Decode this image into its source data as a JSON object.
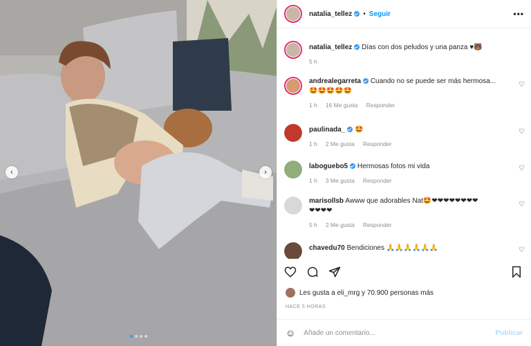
{
  "header": {
    "username": "natalia_tellez",
    "separator": "•",
    "follow_label": "Seguir",
    "more_icon": "•••"
  },
  "photo": {
    "prev_icon": "‹",
    "next_icon": "›",
    "dots": 4,
    "active_dot": 0
  },
  "caption": {
    "username": "natalia_tellez",
    "text": "Días con dos peludos y una panza ♥🐻",
    "time": "5 h"
  },
  "comments": [
    {
      "username": "andrealegarreta",
      "verified": true,
      "text": "Cuando no se puede ser más hermosa...",
      "line2": "🤩🤩🤩🤩🤩",
      "time": "1 h",
      "likes": "16 Me gusta",
      "reply": "Responder"
    },
    {
      "username": "paulinada_",
      "verified": true,
      "text": "🤩",
      "time": "1 h",
      "likes": "2 Me gusta",
      "reply": "Responder"
    },
    {
      "username": "laboguebo5",
      "verified": true,
      "text": "Hermosas fotos mi vida",
      "time": "1 h",
      "likes": "3 Me gusta",
      "reply": "Responder"
    },
    {
      "username": "marisollsb",
      "verified": false,
      "text": "Awww que adorables Nat🤩❤❤❤❤❤❤❤❤",
      "line2": "❤❤❤❤",
      "time": "5 h",
      "likes": "2 Me gusta",
      "reply": "Responder"
    },
    {
      "username": "chavedu70",
      "verified": false,
      "text": "Bendiciones 🙏🙏🙏🙏🙏🙏",
      "time": "",
      "likes": "",
      "reply": ""
    }
  ],
  "likes_line": "Les gusta a eli_mrg y 70.900 personas más",
  "date": "HACE 5 HORAS",
  "add_comment": {
    "placeholder": "Añade un comentario...",
    "publish": "Publicar"
  },
  "colors": {
    "accent": "#0095f6",
    "verified": "#3897f0",
    "muted": "#8e8e8e"
  }
}
